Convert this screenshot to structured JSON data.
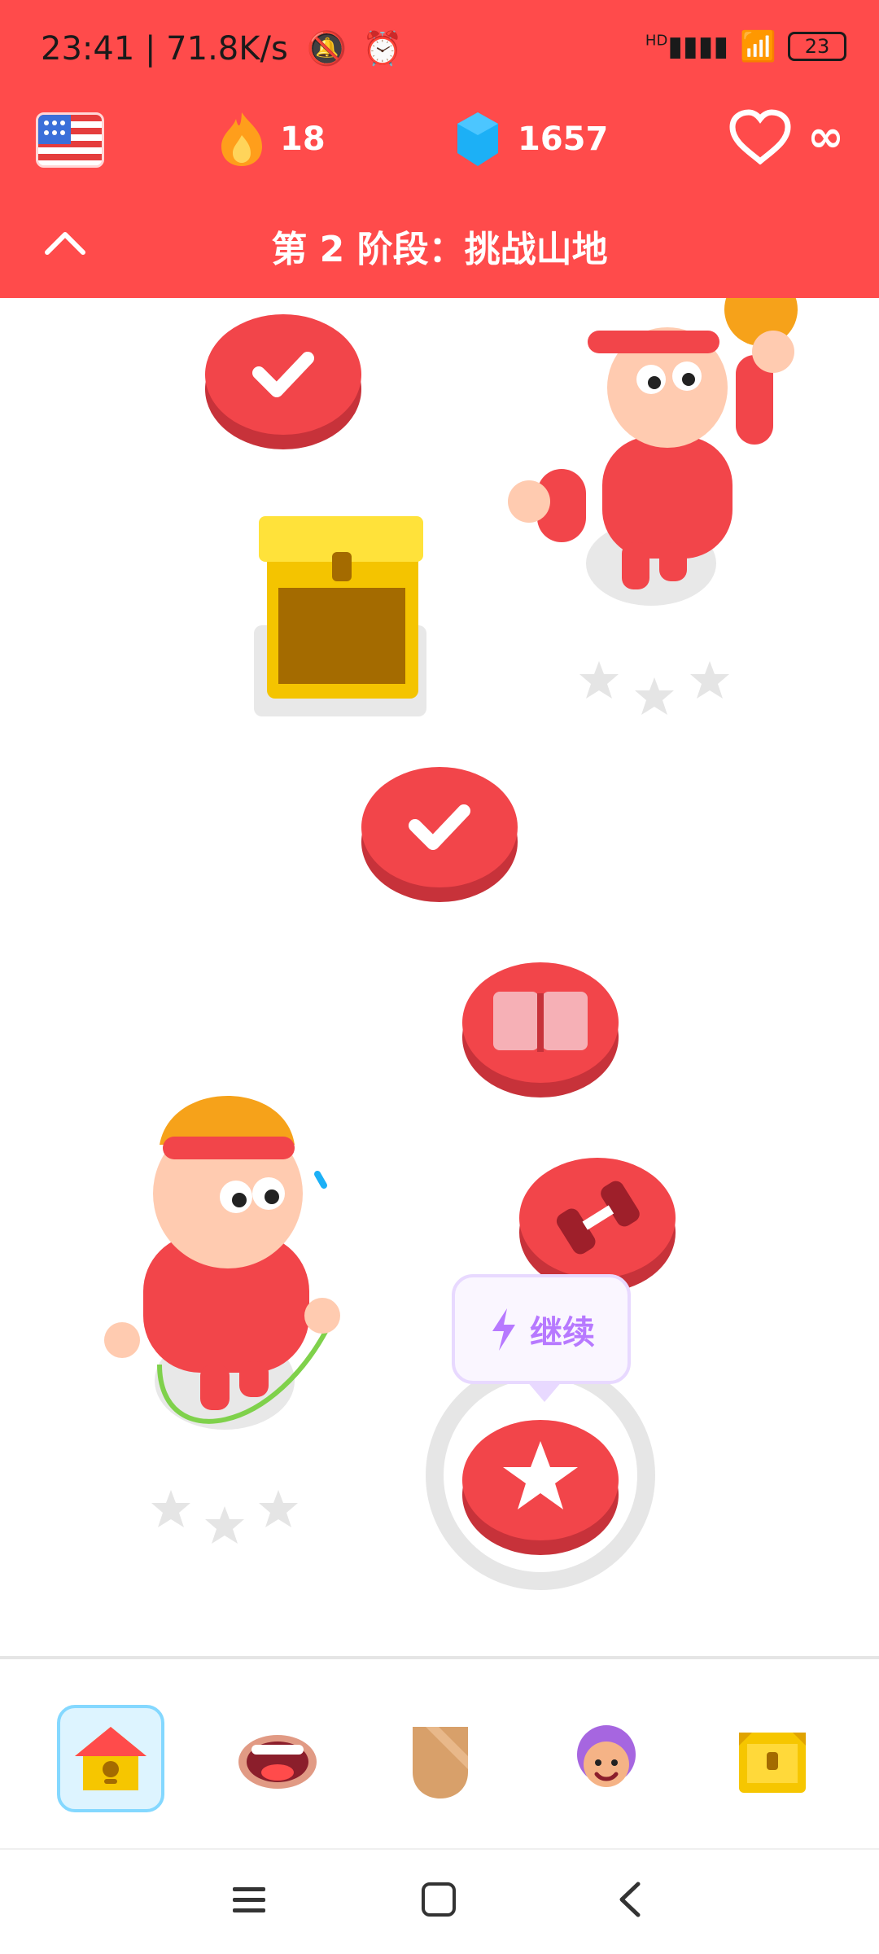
{
  "status": {
    "time_speed": "23:41 | 71.8K/s",
    "battery": "23",
    "network": "HD"
  },
  "stats": {
    "streak": "18",
    "gems": "1657",
    "hearts": "∞",
    "course_flag_icon": "us-flag-icon",
    "streak_icon": "fire-icon",
    "gems_icon": "gem-icon",
    "hearts_icon": "heart-icon"
  },
  "unit": {
    "title": "第 2 阶段：挑战山地",
    "collapse_icon": "chevron-up-icon"
  },
  "path": {
    "continue_label": "继续",
    "nodes": [
      {
        "state": "completed",
        "icon": "check-icon"
      },
      {
        "state": "reward",
        "icon": "treasure-chest-icon"
      },
      {
        "state": "completed",
        "icon": "check-icon"
      },
      {
        "state": "story",
        "icon": "book-icon"
      },
      {
        "state": "practice",
        "icon": "dumbbell-icon"
      },
      {
        "state": "current",
        "icon": "star-icon"
      }
    ]
  },
  "bottom_nav": [
    {
      "name": "home",
      "icon": "home-icon",
      "active": true
    },
    {
      "name": "speak",
      "icon": "mouth-icon",
      "active": false
    },
    {
      "name": "league",
      "icon": "shield-icon",
      "active": false
    },
    {
      "name": "profile",
      "icon": "avatar-icon",
      "active": false
    },
    {
      "name": "shop",
      "icon": "chest-icon",
      "active": false
    }
  ],
  "colors": {
    "brand_red": "#FF4B4B",
    "node_red": "#F2454A",
    "node_shadow": "#C7323A",
    "gold": "#F5C400",
    "purple": "#B779FF"
  }
}
